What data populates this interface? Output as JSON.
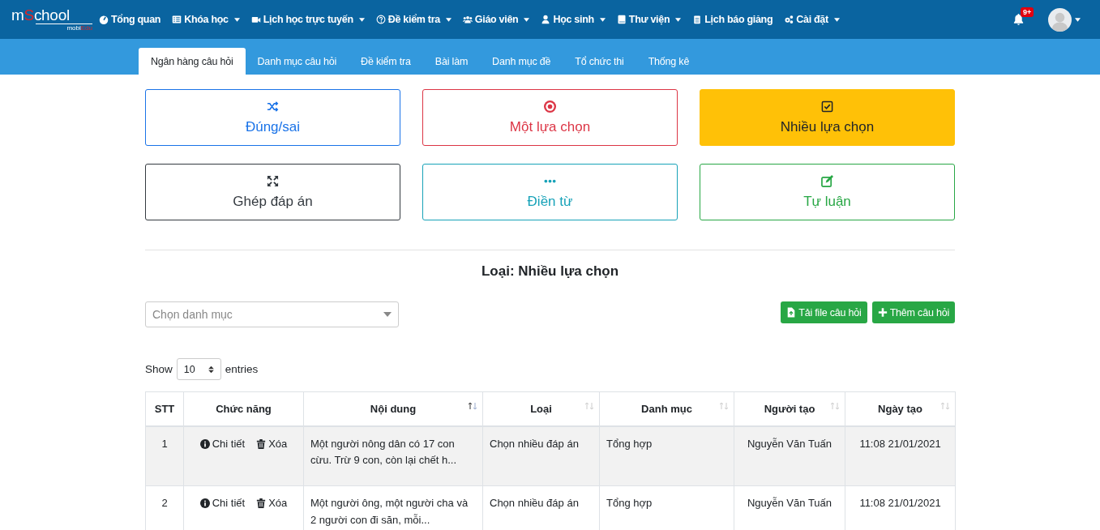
{
  "logo": {
    "main_start": "m",
    "main_accent": "S",
    "main_end": "chool",
    "sub_start": "mobi",
    "sub_accent": "Edu"
  },
  "nav": [
    {
      "label": "Tổng quan",
      "kind": "gauge",
      "dropdown": false
    },
    {
      "label": "Khóa học",
      "kind": "list",
      "dropdown": true
    },
    {
      "label": "Lịch học trực tuyến",
      "kind": "video",
      "dropdown": true
    },
    {
      "label": "Đề kiểm tra",
      "kind": "question",
      "dropdown": true
    },
    {
      "label": "Giáo viên",
      "kind": "users",
      "dropdown": true
    },
    {
      "label": "Học sinh",
      "kind": "user",
      "dropdown": true
    },
    {
      "label": "Thư viện",
      "kind": "book",
      "dropdown": true
    },
    {
      "label": "Lịch báo giảng",
      "kind": "clipboard",
      "dropdown": false
    },
    {
      "label": "Cài đặt",
      "kind": "cogs",
      "dropdown": true
    }
  ],
  "notifications": {
    "badge": "9+"
  },
  "tabs": [
    {
      "label": "Ngân hàng câu hỏi",
      "selected": true
    },
    {
      "label": "Danh mục câu hỏi",
      "selected": false
    },
    {
      "label": "Đề kiểm tra",
      "selected": false
    },
    {
      "label": "Bài làm",
      "selected": false
    },
    {
      "label": "Danh mục đề",
      "selected": false
    },
    {
      "label": "Tổ chức thi",
      "selected": false
    },
    {
      "label": "Thống kê",
      "selected": false
    }
  ],
  "question_types": [
    {
      "label": "Đúng/sai",
      "kind": "shuffle",
      "color": "#1a73e8",
      "selected": false
    },
    {
      "label": "Một lựa chọn",
      "kind": "radio",
      "color": "#dc3545",
      "selected": false
    },
    {
      "label": "Nhiều lựa chọn",
      "kind": "checkbox",
      "color": "#ffc107",
      "selected": true
    },
    {
      "label": "Ghép đáp án",
      "kind": "matching",
      "color": "#343a40",
      "selected": false
    },
    {
      "label": "Điền từ",
      "kind": "fill",
      "color": "#17a2b8",
      "selected": false
    },
    {
      "label": "Tự luận",
      "kind": "essay",
      "color": "#28a745",
      "selected": false
    }
  ],
  "section_title": "Loại: Nhiều lựa chọn",
  "category_select": {
    "placeholder": "Chọn danh mục"
  },
  "buttons": [
    {
      "label": "Tải file câu hỏi",
      "kind": "upload"
    },
    {
      "label": "Thêm câu hỏi",
      "kind": "add"
    }
  ],
  "length_control": {
    "before": "Show",
    "value": "10",
    "after": "entries"
  },
  "table": {
    "columns": [
      {
        "label": "STT",
        "sortable": false
      },
      {
        "label": "Chức năng",
        "sortable": false
      },
      {
        "label": "Nội dung",
        "sortable": true,
        "sorted": true
      },
      {
        "label": "Loại",
        "sortable": true,
        "sorted": false
      },
      {
        "label": "Danh mục",
        "sortable": true,
        "sorted": false
      },
      {
        "label": "Người tạo",
        "sortable": true,
        "sorted": false
      },
      {
        "label": "Ngày tạo",
        "sortable": true,
        "sorted": false
      }
    ],
    "rows": [
      {
        "stt": "1",
        "actions": [
          "Chi tiết",
          "Xóa"
        ],
        "content": "Một người nông dân có 17 con cừu. Trừ 9 con, còn lại chết h...",
        "type": "Chọn nhiều đáp án",
        "category": "Tổng hợp",
        "creator": "Nguyễn Văn Tuấn",
        "date": "11:08 21/01/2021"
      },
      {
        "stt": "2",
        "actions": [
          "Chi tiết",
          "Xóa"
        ],
        "content": "Một người ông, một người cha và 2 người con đi săn, mỗi...",
        "type": "Chọn nhiều đáp án",
        "category": "Tổng hợp",
        "creator": "Nguyễn Văn Tuấn",
        "date": "11:08 21/01/2021"
      }
    ]
  }
}
